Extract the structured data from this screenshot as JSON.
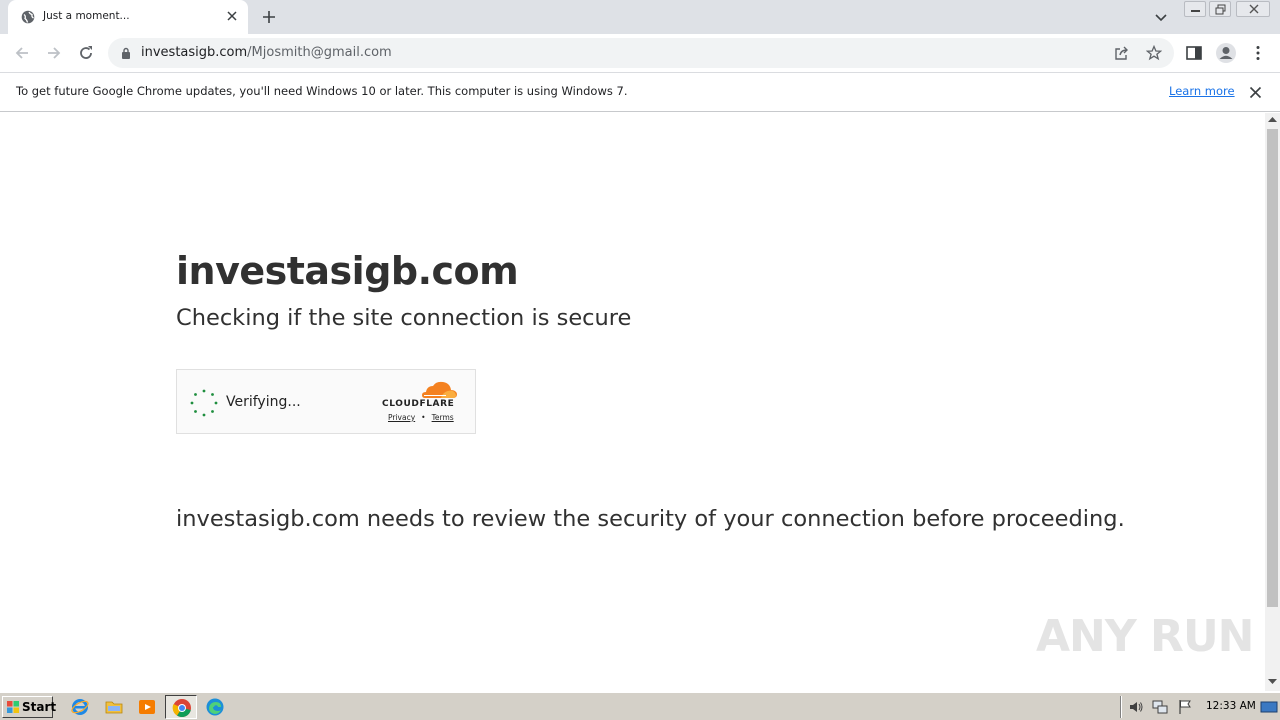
{
  "browser": {
    "tab_title": "Just a moment...",
    "url_domain": "investasigb.com",
    "url_path": "/Mjosmith@gmail.com",
    "icons": [
      "globe-icon",
      "close-icon",
      "plus-icon",
      "chevron-down-icon",
      "back-icon",
      "forward-icon",
      "reload-icon",
      "lock-icon",
      "share-icon",
      "star-icon",
      "side-panel-icon",
      "profile-icon",
      "menu-icon"
    ]
  },
  "infobar": {
    "message": "To get future Google Chrome updates, you'll need Windows 10 or later. This computer is using Windows 7.",
    "link": "Learn more"
  },
  "page": {
    "title": "investasigb.com",
    "subtitle": "Checking if the site connection is secure",
    "widget": {
      "status": "Verifying...",
      "brand": "CLOUDFLARE",
      "privacy": "Privacy",
      "separator": "•",
      "terms": "Terms",
      "brand_color": "#f48120"
    },
    "review_text": "investasigb.com needs to review the security of your connection before proceeding."
  },
  "watermark": {
    "text": "ANY RUN"
  },
  "taskbar": {
    "start_label": "Start",
    "clock": "12:33 AM",
    "apps": [
      "internet-explorer-icon",
      "folder-icon",
      "media-player-icon",
      "chrome-icon",
      "edge-icon"
    ]
  }
}
